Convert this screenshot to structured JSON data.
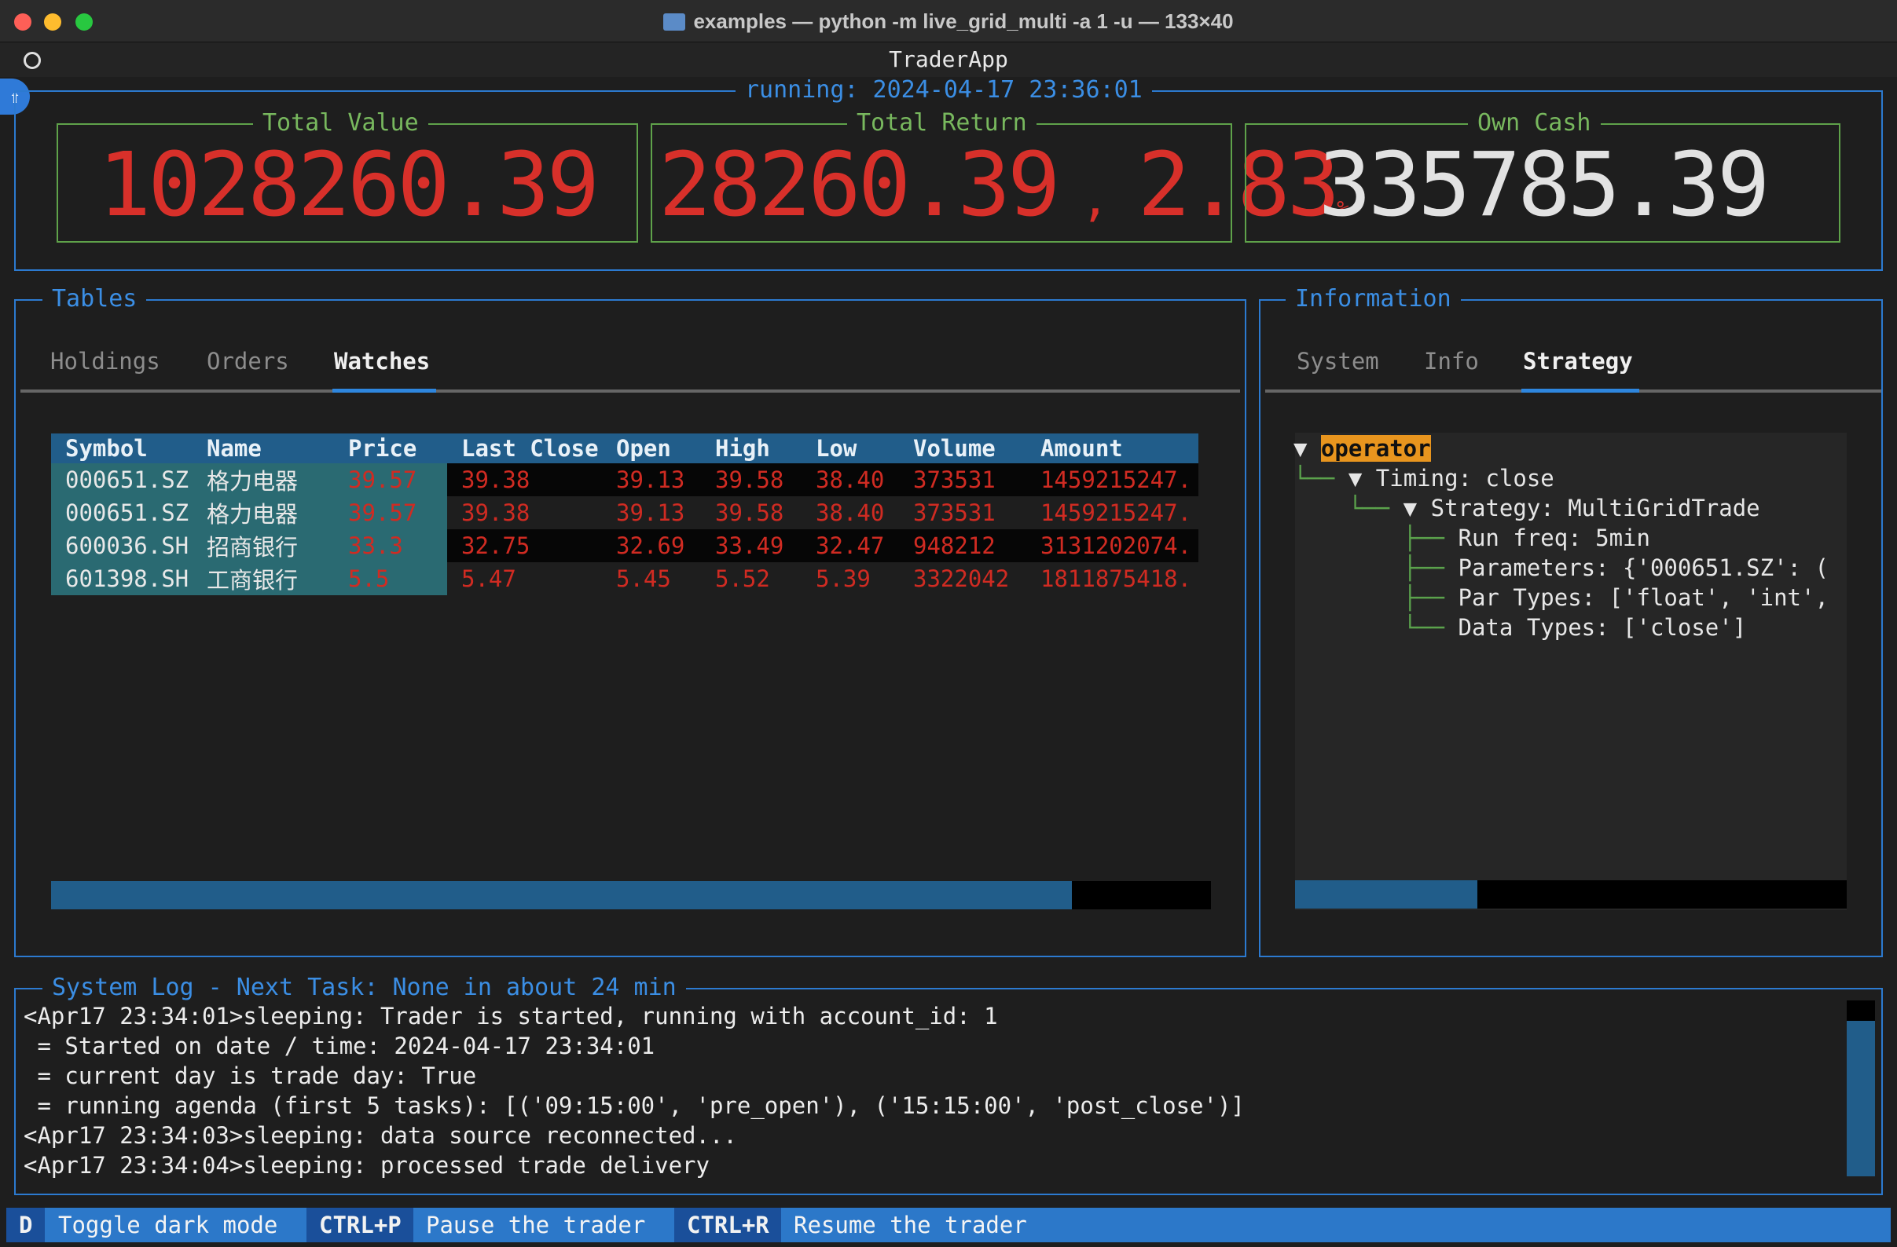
{
  "window": {
    "title": "examples — python -m live_grid_multi -a 1 -u — 133×40"
  },
  "app": {
    "title": "TraderApp",
    "status": "running: 2024-04-17 23:36:01"
  },
  "summary": {
    "total_value": {
      "label": "Total Value",
      "value": "1028260.39"
    },
    "total_return": {
      "label": "Total Return",
      "value": "28260.39",
      "sep": ",",
      "pct": "2.83",
      "pct_sign": "%"
    },
    "own_cash": {
      "label": "Own Cash",
      "value": "335785.39"
    }
  },
  "tables": {
    "title": "Tables",
    "tabs": [
      "Holdings",
      "Orders",
      "Watches"
    ],
    "active_tab": "Watches",
    "columns": [
      "Symbol",
      "Name",
      "Price",
      "Last Close",
      "Open",
      "High",
      "Low",
      "Volume",
      "Amount"
    ],
    "rows": [
      [
        "000651.SZ",
        "格力电器",
        "39.57",
        "39.38",
        "39.13",
        "39.58",
        "38.40",
        "373531",
        "1459215247."
      ],
      [
        "000651.SZ",
        "格力电器",
        "39.57",
        "39.38",
        "39.13",
        "39.58",
        "38.40",
        "373531",
        "1459215247."
      ],
      [
        "600036.SH",
        "招商银行",
        "33.3",
        "32.75",
        "32.69",
        "33.49",
        "32.47",
        "948212",
        "3131202074."
      ],
      [
        "601398.SH",
        "工商银行",
        "5.5",
        "5.47",
        "5.45",
        "5.52",
        "5.39",
        "3322042",
        "1811875418."
      ]
    ],
    "hscroll_fraction": 0.88
  },
  "information": {
    "title": "Information",
    "tabs": [
      "System",
      "Info",
      "Strategy"
    ],
    "active_tab": "Strategy",
    "tree": {
      "root": "operator",
      "timing": "Timing: close",
      "strategy": "Strategy: MultiGridTrade",
      "run_freq": "Run freq: 5min",
      "parameters": "Parameters: {'000651.SZ': (",
      "par_types": "Par Types: ['float', 'int',",
      "data_types": "Data Types: ['close']"
    },
    "hscroll_fraction": 0.33
  },
  "log": {
    "title": "System Log - Next Task: None in about 24 min",
    "lines": [
      "<Apr17 23:34:01>sleeping: Trader is started, running with account_id: 1",
      " = Started on date / time: 2024-04-17 23:34:01",
      " = current day is trade day: True",
      " = running agenda (first 5 tasks): [('09:15:00', 'pre_open'), ('15:15:00', 'post_close')]",
      "<Apr17 23:34:03>sleeping: data source reconnected...",
      "<Apr17 23:34:04>sleeping: processed trade delivery"
    ]
  },
  "footer": {
    "k1": "D",
    "l1": "Toggle dark mode",
    "k2": "CTRL+P",
    "l2": "Pause the trader",
    "k3": "CTRL+R",
    "l3": "Resume the trader"
  },
  "colors": {
    "accent": "#2c7ad0",
    "positive": "#d02b22",
    "card_border": "#5fa24a",
    "highlight": "#e8951e"
  }
}
